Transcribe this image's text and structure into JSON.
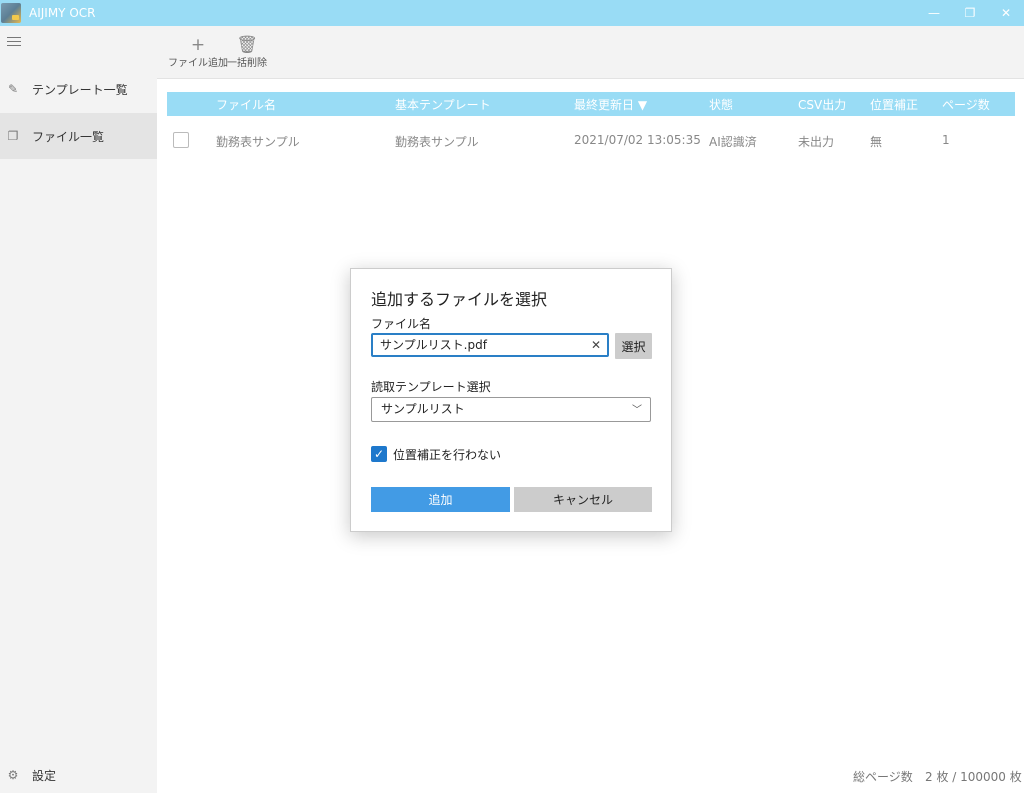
{
  "window": {
    "title": "AIJIMY OCR",
    "controls": {
      "minimize": "—",
      "restore": "❐",
      "close": "✕"
    }
  },
  "sidebar": {
    "items": [
      {
        "label": "テンプレート一覧",
        "icon": "template-edit-icon"
      },
      {
        "label": "ファイル一覧",
        "icon": "file-list-icon"
      }
    ],
    "settings_label": "設定"
  },
  "toolbar": {
    "add_label": "ファイル追加",
    "delete_label": "一括削除"
  },
  "table": {
    "headers": [
      "ファイル名",
      "基本テンプレート",
      "最終更新日 ▼",
      "状態",
      "CSV出力",
      "位置補正",
      "ページ数"
    ],
    "rows": [
      [
        "勤務表サンプル",
        "勤務表サンプル",
        "2021/07/02 13:05:35",
        "AI認識済",
        "未出力",
        "無",
        "1"
      ]
    ]
  },
  "footer": {
    "label": "総ページ数",
    "value": "2 枚 / 100000 枚"
  },
  "dialog": {
    "title": "追加するファイルを選択",
    "file_label": "ファイル名",
    "file_value": "サンプルリスト.pdf",
    "choose_label": "選択",
    "template_label": "読取テンプレート選択",
    "template_value": "サンプルリスト",
    "checkbox_label": "位置補正を行わない",
    "checkbox_checked": true,
    "add_label": "追加",
    "cancel_label": "キャンセル"
  },
  "colors": {
    "accent": "#99dcf5",
    "primary_button": "#429be5",
    "checkbox": "#1e78cc"
  }
}
